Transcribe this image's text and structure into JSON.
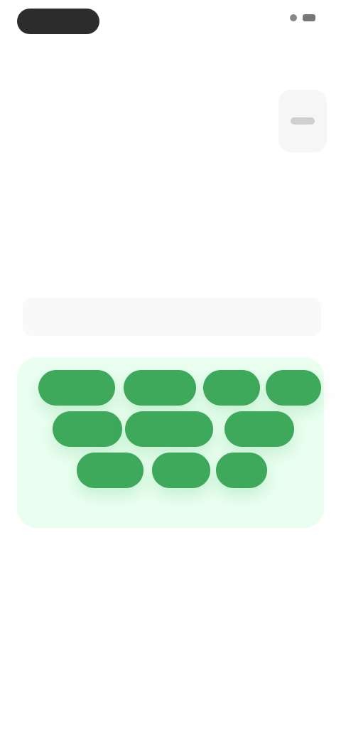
{
  "status": {
    "left_pill": "",
    "right": ""
  },
  "top_action": {
    "label": ""
  },
  "header": {
    "title": "",
    "description": ""
  },
  "search": {
    "placeholder": "",
    "value": ""
  },
  "chips": [
    {
      "label": ""
    },
    {
      "label": ""
    },
    {
      "label": ""
    },
    {
      "label": ""
    },
    {
      "label": ""
    },
    {
      "label": ""
    },
    {
      "label": ""
    },
    {
      "label": ""
    },
    {
      "label": ""
    },
    {
      "label": ""
    }
  ],
  "colors": {
    "chip_green": "#3ea85b",
    "chip_area": "#eafff0",
    "status_pill": "#2c2c2c"
  }
}
